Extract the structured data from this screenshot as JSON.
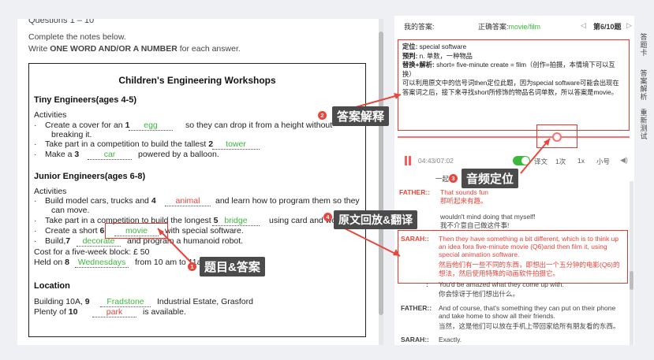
{
  "question": {
    "range": "Questions 1 – 10",
    "instruction": "Complete the notes below.",
    "instruction2_pre": "Write ",
    "instruction2_bold": "ONE WORD AND/OR A NUMBER",
    "instruction2_post": " for each answer.",
    "title": "Children's Engineering Workshops",
    "section1": {
      "heading": "Tiny Engineers(ages 4-5)",
      "activities": "Activities",
      "line1_pre": "Create a cover for an ",
      "line1_num": "1",
      "line1_answer": "egg",
      "line1_post": "so they can drop it from a height without",
      "line1_cont": "breaking it.",
      "line2_pre": "Take part in a competition to build the tallest ",
      "line2_num": "2",
      "line2_answer": "tower",
      "line3_pre": "Make a ",
      "line3_num": "3",
      "line3_answer": "car",
      "line3_post": "powered by a balloon."
    },
    "section2": {
      "heading": "Junior Engineers(ages 6-8)",
      "activities": "Activities",
      "line4_pre": "Build model cars, trucks and ",
      "line4_num": "4",
      "line4_answer": "animal",
      "line4_post": "and learn how to program them so they",
      "line4_cont": "can move.",
      "line5_pre": "Take part in a competition to build the longest ",
      "line5_num": "5",
      "line5_answer": "bridge",
      "line5_post": "using card and wood",
      "line6_pre": "Create a short ",
      "line6_num": "6",
      "line6_answer": "movie",
      "line6_post": "with special software.",
      "line7_pre": "Build,",
      "line7_num": "7",
      "line7_answer": "decorate",
      "line7_post": "and program a humanoid robot.",
      "cost": "Cost for a five-week block: £ 50",
      "held_pre": "Held on ",
      "held_num": "8",
      "held_answer": "Wednesdays",
      "held_post": "from 10 am to 11am"
    },
    "location": {
      "heading": "Location",
      "building_pre": "Building 10A, ",
      "building_num": "9",
      "building_answer": "Fradstone",
      "building_post": "Industrial Estate, Grasford",
      "plenty_pre": "Plenty of ",
      "plenty_num": "10",
      "plenty_answer": "park",
      "plenty_post": "is available."
    }
  },
  "answer_header": {
    "my_answer_label": "我的答案:",
    "correct_label": "正确答案:",
    "correct_value": "movie/film",
    "nav_prev": "◁",
    "nav_position": "第6/10题",
    "nav_next": "▷"
  },
  "explanation": {
    "locate_label": "定位:",
    "locate_text": "special software",
    "predict_label": "预判:",
    "predict_text": "n. 单数，一种物品",
    "replace_label": "替换+解析:",
    "replace_text": "short= five-minute  create = film（创作=拍摄，本情境下可以互换）",
    "analysis": "可以利用原文中的信号词then定位此题，因为special software可能会出现在答案词之后，接下来寻找short所修饰的物品名词单数，所以答案是movie。"
  },
  "player": {
    "time": "04:43/07:02",
    "translation_label": "译文",
    "times_label": "1次",
    "speed": "1x",
    "font_size": "小号",
    "volume_icon": "◀)"
  },
  "transcript": {
    "line0": "一起",
    "father1_speaker": "FATHER::",
    "father1_en": "That sounds fun",
    "father1_cn": "那听起来有趣。",
    "mid_en": "wouldn't mind doing that myself!",
    "mid_cn": "我不介意自己做这件事!",
    "sarah1_speaker": "SARAH::",
    "sarah1_en1": "Then they have something a bit different, which is to think up",
    "sarah1_en2": "an idea fora five-minute movie (Q6)and then film it, using",
    "sarah1_en3": "special animation software.",
    "sarah1_cn1": "然后他们有一些不同的东西，即想出一个五分钟的电影(Q6)的",
    "sarah1_cn2": "想法，然后使用特殊的动画软件拍摄它。",
    "l_speaker": ":",
    "l_en": "You'd be amazed what they come up with.",
    "l_cn": "你会惊讶于他们想出什么。",
    "father2_speaker": "FATHER::",
    "father2_en1": "And of course, that's something they can put on their phone",
    "father2_en2": "and take home to show all their friends.",
    "father2_cn": "当然，这是他们可以放在手机上带回家给所有朋友看的东西。",
    "sarah2_speaker": "SARAH::",
    "sarah2_en": "Exactly."
  },
  "side_tabs": [
    "答题卡",
    "答案解析",
    "重新测试"
  ],
  "callouts": {
    "c1_num": "1",
    "c1_label": "题目&答案",
    "c2_num": "2",
    "c2_label": "答案解释",
    "c3_num": "3",
    "c3_label": "音频定位",
    "c4_num": "4",
    "c4_label": "原文回放&翻译"
  },
  "colors": {
    "green_answer": "#3cb83c",
    "red_answer": "#e8453c",
    "callout_bg": "#4b4b4b",
    "highlight_frame": "#e03a2c"
  }
}
